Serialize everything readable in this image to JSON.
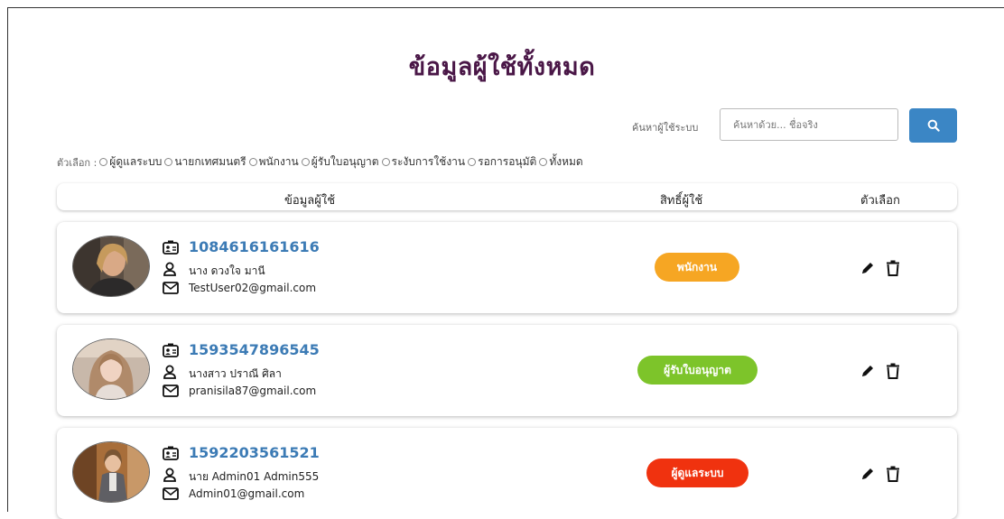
{
  "page": {
    "title": "ข้อมูลผู้ใช้ทั้งหมด"
  },
  "search": {
    "label": "ค้นหาผู้ใช้ระบบ",
    "placeholder": "ค้นหาด้วย... ชื่อจริง",
    "button_icon": "search-icon"
  },
  "filters": {
    "label": "ตัวเลือก :",
    "options": [
      "ผู้ดูแลระบบ",
      "นายกเทศมนตรี",
      "พนักงาน",
      "ผู้รับใบอนุญาต",
      "ระงับการใช้งาน",
      "รอการอนุมัติ",
      "ทั้งหมด"
    ]
  },
  "table": {
    "headers": [
      "ข้อมูลผู้ใช้",
      "สิทธิ์ผู้ใช้",
      "ตัวเลือก"
    ]
  },
  "users": [
    {
      "id": "1084616161616",
      "name": "นาง ดวงใจ มานี",
      "email": "TestUser02@gmail.com",
      "role": "พนักงาน",
      "role_color": "#f6a623"
    },
    {
      "id": "1593547896545",
      "name": "นางสาว ปราณี ศิลา",
      "email": "pranisila87@gmail.com",
      "role": "ผู้รับใบอนุญาต",
      "role_color": "#7dc42a"
    },
    {
      "id": "1592203561521",
      "name": "นาย Admin01 Admin555",
      "email": "Admin01@gmail.com",
      "role": "ผู้ดูแลระบบ",
      "role_color": "#f0320f"
    }
  ],
  "colors": {
    "title": "#4a1747",
    "accent": "#3b86c5",
    "id_text": "#3c7bb5"
  }
}
